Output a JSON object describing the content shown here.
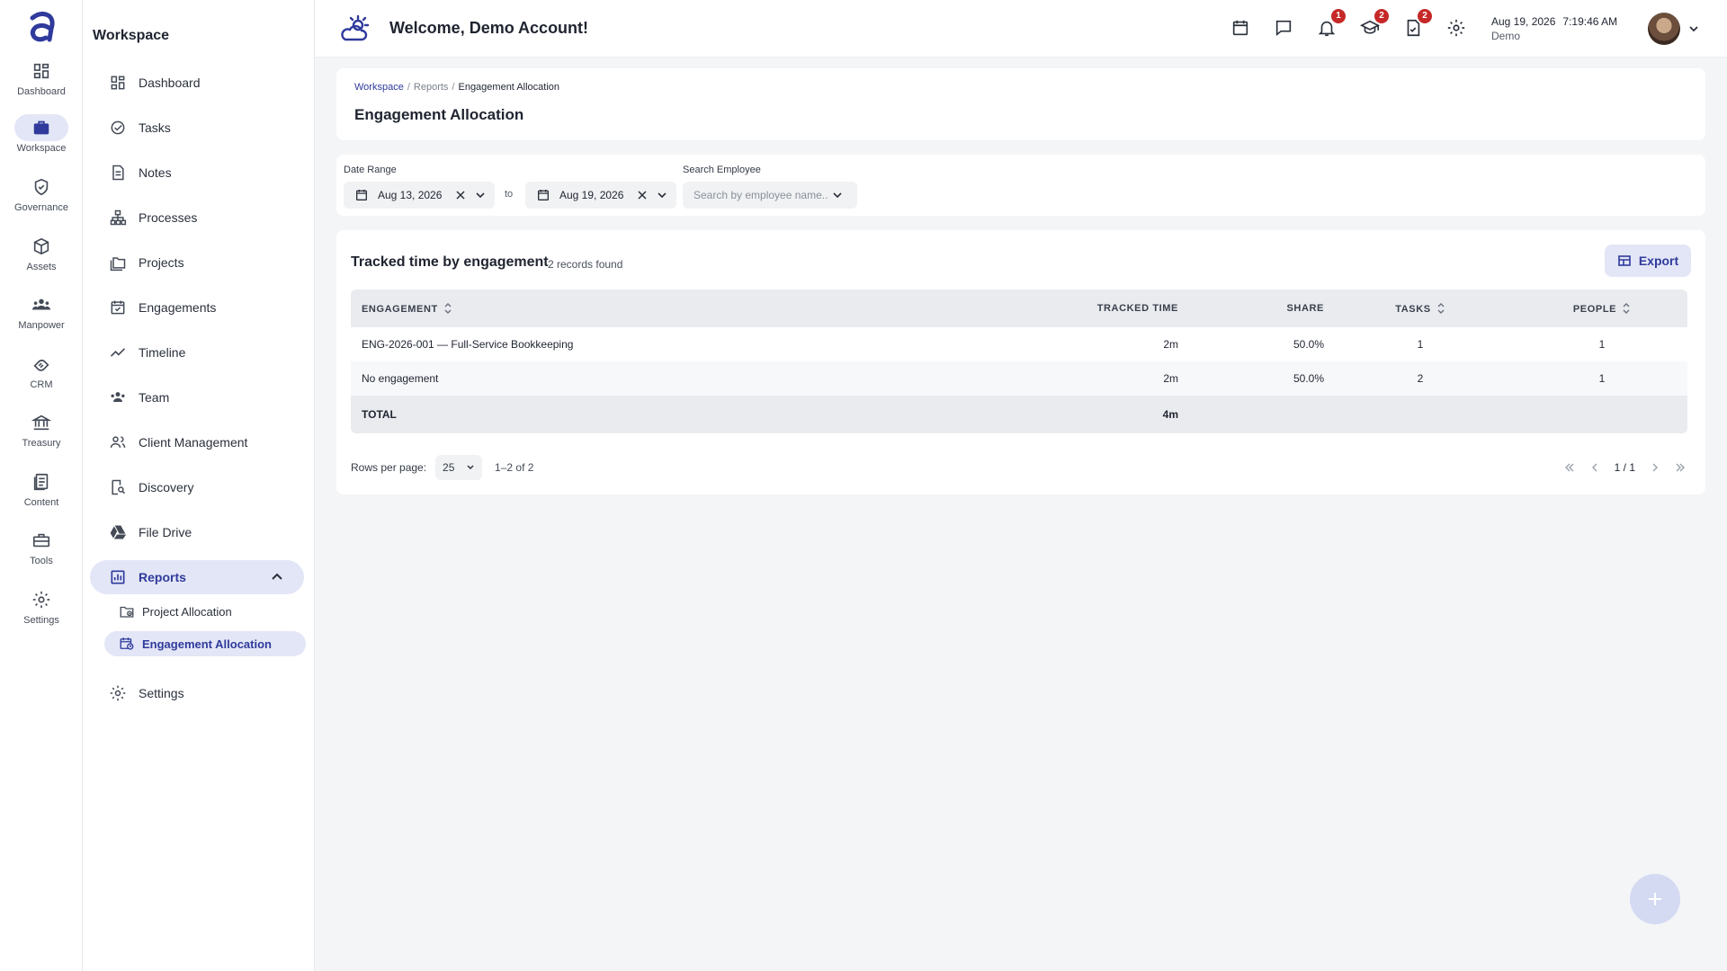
{
  "colors": {
    "accent": "#2f3a9c",
    "accent_soft": "#e3e6f6",
    "badge": "#c62828"
  },
  "rail": {
    "items": [
      {
        "label": "Dashboard",
        "icon": "grid-icon"
      },
      {
        "label": "Workspace",
        "icon": "briefcase-icon",
        "active": true
      },
      {
        "label": "Governance",
        "icon": "shield-check-icon"
      },
      {
        "label": "Assets",
        "icon": "cube-icon"
      },
      {
        "label": "Manpower",
        "icon": "people-icon"
      },
      {
        "label": "CRM",
        "icon": "handshake-icon"
      },
      {
        "label": "Treasury",
        "icon": "bank-icon"
      },
      {
        "label": "Content",
        "icon": "document-icon"
      },
      {
        "label": "Tools",
        "icon": "toolbox-icon"
      },
      {
        "label": "Settings",
        "icon": "gear-icon"
      }
    ]
  },
  "subnav": {
    "title": "Workspace",
    "items": [
      {
        "label": "Dashboard"
      },
      {
        "label": "Tasks"
      },
      {
        "label": "Notes"
      },
      {
        "label": "Processes"
      },
      {
        "label": "Projects"
      },
      {
        "label": "Engagements"
      },
      {
        "label": "Timeline"
      },
      {
        "label": "Team"
      },
      {
        "label": "Client Management"
      },
      {
        "label": "Discovery"
      },
      {
        "label": "File Drive"
      },
      {
        "label": "Reports"
      },
      {
        "label": "Settings"
      }
    ],
    "reports_children": [
      {
        "label": "Project Allocation"
      },
      {
        "label": "Engagement Allocation",
        "active": true
      }
    ]
  },
  "topbar": {
    "welcome": "Welcome, Demo Account!",
    "badges": {
      "notifications": "1",
      "learning": "2",
      "approvals": "2"
    },
    "date": "Aug 19, 2026",
    "time": "7:19:46 AM",
    "user": "Demo"
  },
  "header": {
    "breadcrumb": {
      "root": "Workspace",
      "middle": "Reports",
      "current": "Engagement Allocation"
    },
    "title": "Engagement Allocation"
  },
  "filters": {
    "date_range_label": "Date Range",
    "start_date": "Aug 13, 2026",
    "to": "to",
    "end_date": "Aug 19, 2026",
    "search_label": "Search Employee",
    "search_placeholder": "Search by employee name..."
  },
  "table_card": {
    "title": "Tracked time by engagement",
    "records": "2 records found",
    "export": "Export",
    "columns": {
      "engagement": "Engagement",
      "tracked_time": "Tracked Time",
      "share": "Share",
      "tasks": "Tasks",
      "people": "People"
    },
    "rows": [
      {
        "engagement": "ENG-2026-001 — Full-Service Bookkeeping",
        "tracked_time": "2m",
        "share": "50.0%",
        "tasks": "1",
        "people": "1"
      },
      {
        "engagement": "No engagement",
        "tracked_time": "2m",
        "share": "50.0%",
        "tasks": "2",
        "people": "1"
      }
    ],
    "total": {
      "label": "TOTAL",
      "tracked_time": "4m"
    },
    "pagination": {
      "rows_per_page_label": "Rows per page:",
      "rows_per_page": "25",
      "range": "1–2 of 2",
      "page": "1 / 1"
    }
  }
}
